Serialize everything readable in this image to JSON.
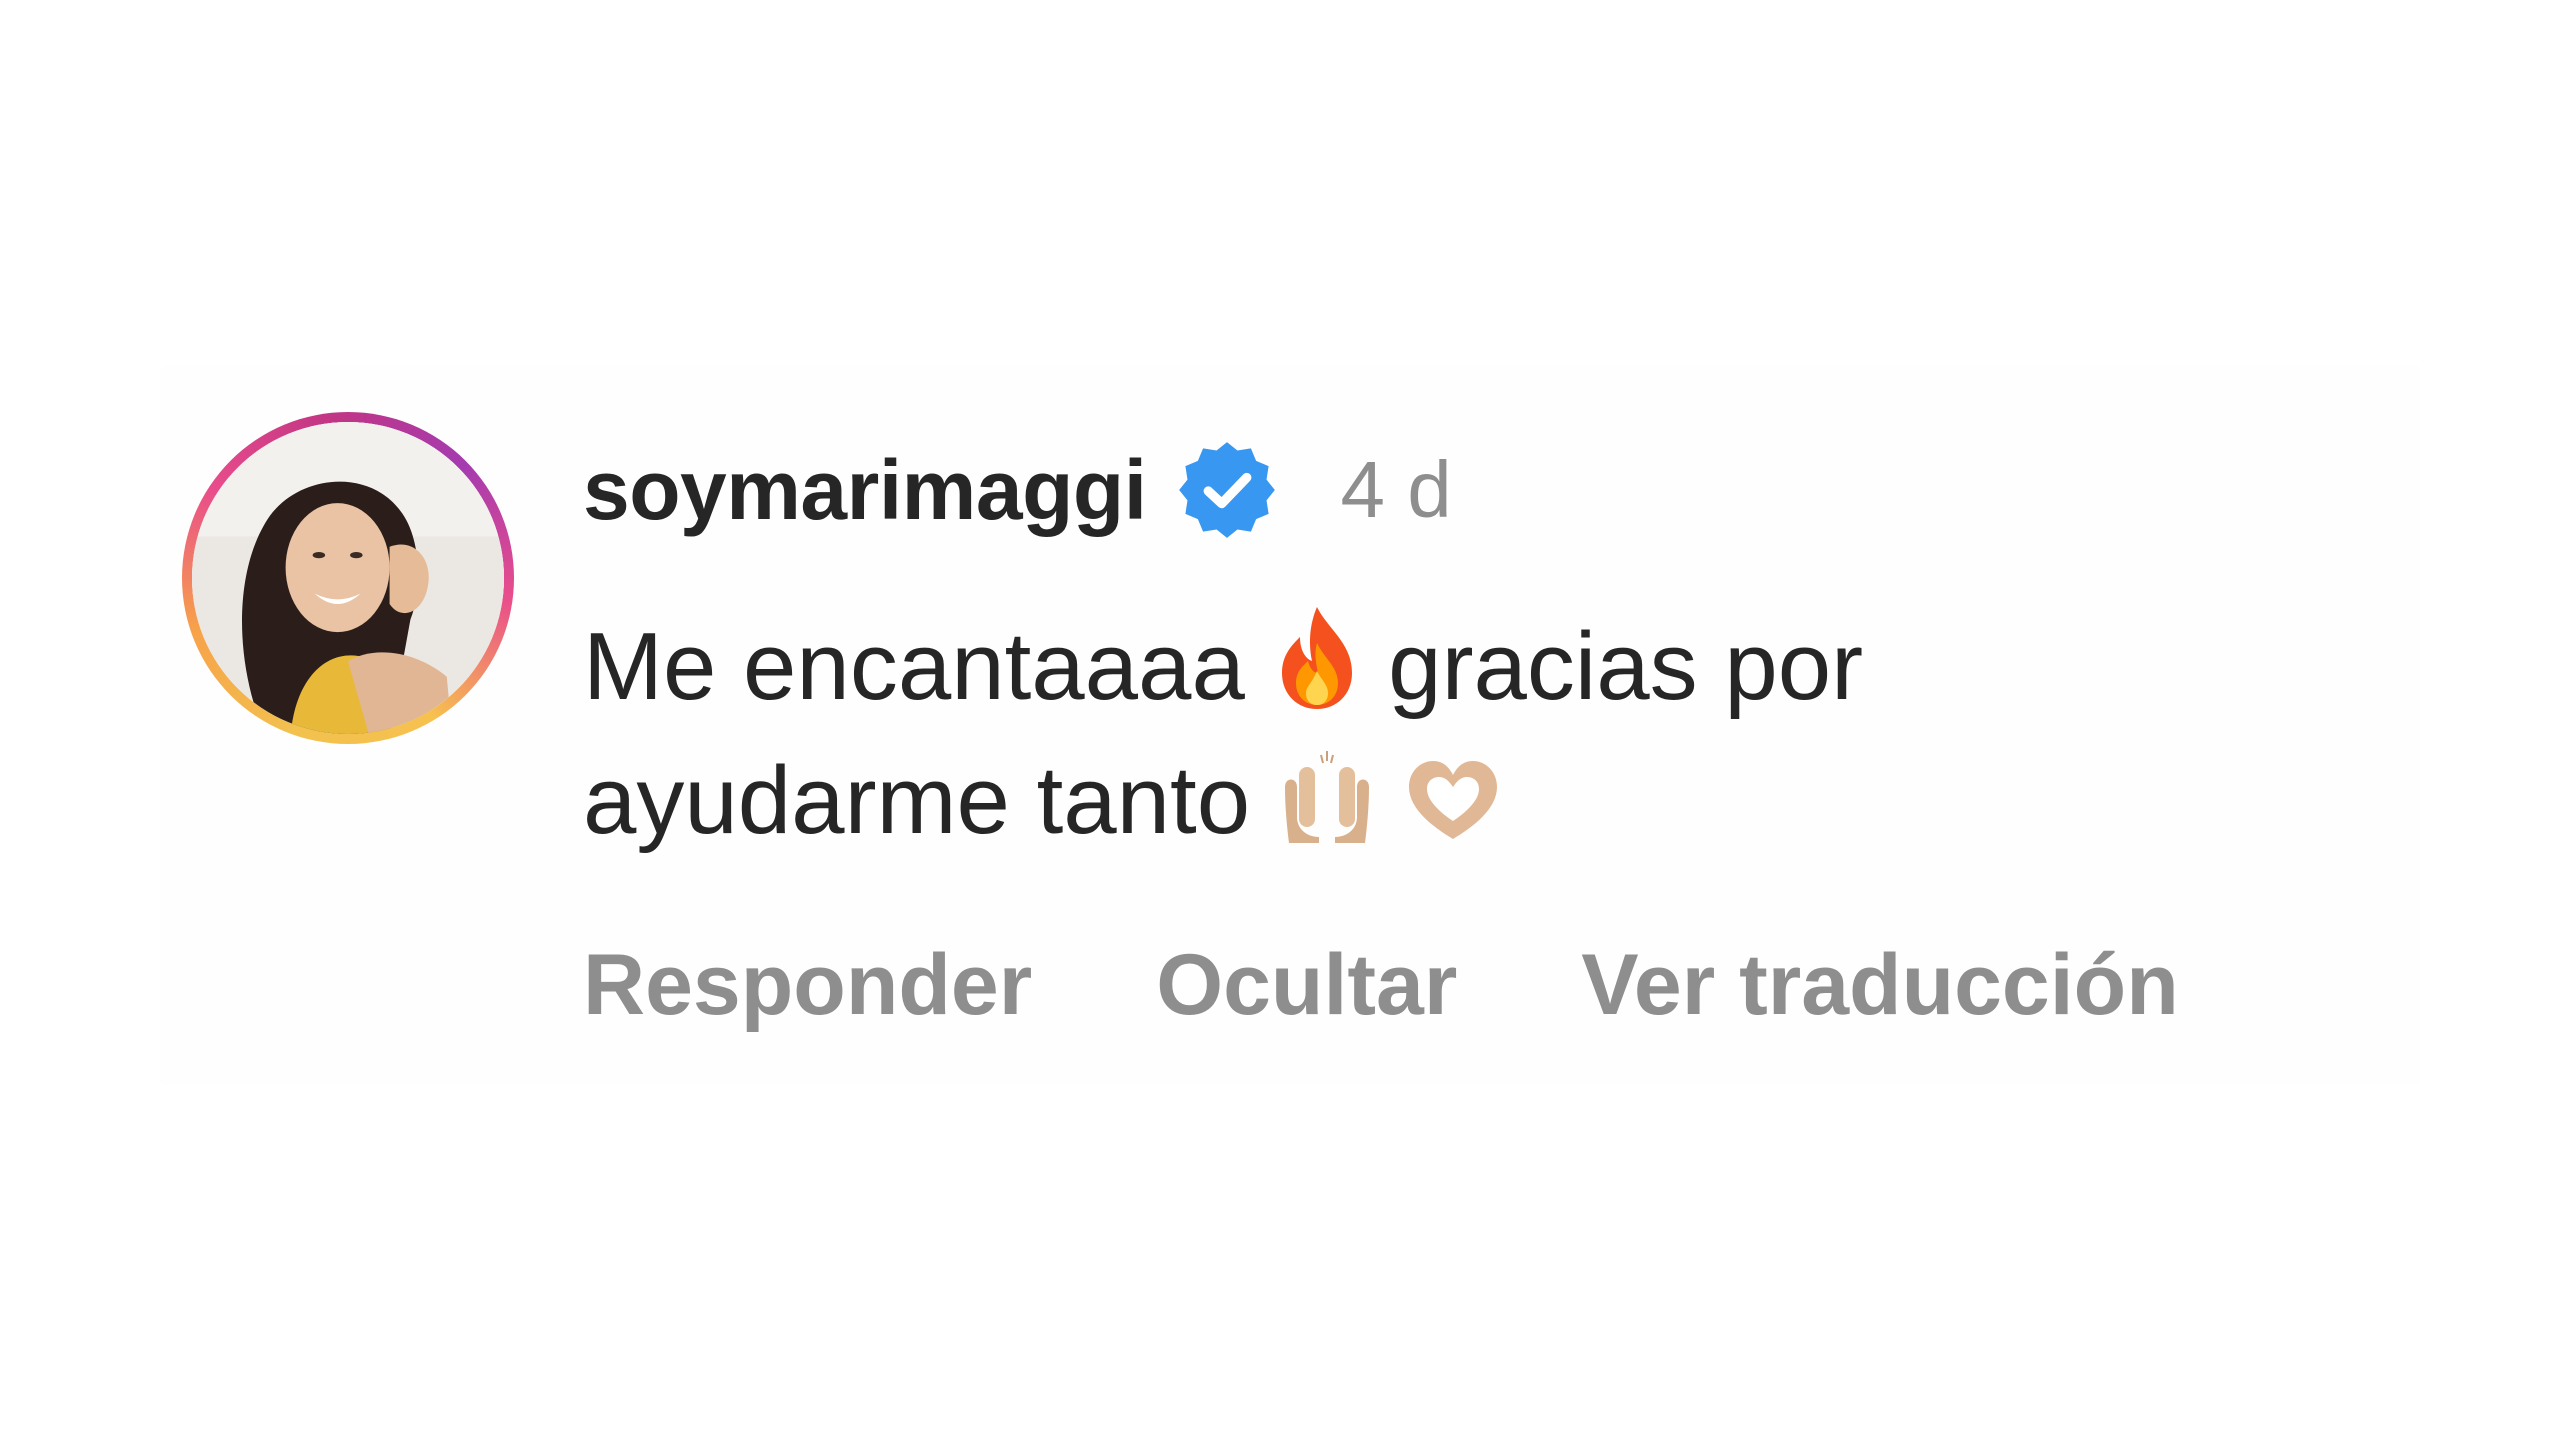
{
  "comment": {
    "username": "soymarimaggi",
    "verified_icon": "verified-badge-icon",
    "time": "4 d",
    "text_line1": "Me encantaaaa",
    "text_line1_emoji": "fire-emoji",
    "text_line1_tail": "gracias por",
    "text_line2": "ayudarme tanto",
    "text_line2_emojis": [
      "raised-hands-emoji",
      "heart-hands-emoji"
    ],
    "actions": {
      "reply": "Responder",
      "hide": "Ocultar",
      "translate": "Ver traducción"
    }
  },
  "colors": {
    "text": "#262626",
    "muted": "#8e8e8e",
    "verified": "#3897f0",
    "ring_start": "#f2c14e",
    "ring_end": "#c13584"
  }
}
